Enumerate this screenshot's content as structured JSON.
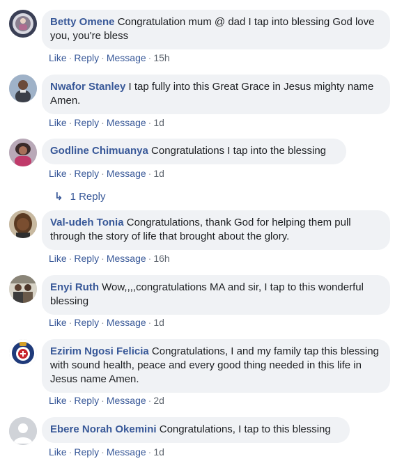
{
  "comments": [
    {
      "author": "Betty Omene",
      "text": "Congratulation mum @ dad I tap into blessing God love you, you're bless",
      "time": "15h"
    },
    {
      "author": "Nwafor Stanley",
      "text": "I tap fully into this Great Grace in Jesus mighty name Amen.",
      "time": "1d"
    },
    {
      "author": "Godline Chimuanya",
      "text": "Congratulations I tap into the blessing",
      "time": "1d"
    },
    {
      "author": "Val-udeh Tonia",
      "text": "Congratulations, thank God for helping them pull through the story of life that brought about the glory.",
      "time": "16h"
    },
    {
      "author": "Enyi Ruth",
      "text": "Wow,,,,congratulations MA and sir, I tap to this wonderful blessing",
      "time": "1d"
    },
    {
      "author": "Ezirim Ngosi Felicia",
      "text": "Congratulations, I and my family tap this blessing with sound health, peace and every good thing needed in this life in Jesus name Amen.",
      "time": "2d"
    },
    {
      "author": "Ebere Norah Okemini",
      "text": "Congratulations, I tap to this blessing",
      "time": "1d"
    }
  ],
  "actions": {
    "like": "Like",
    "reply": "Reply",
    "message": "Message"
  },
  "replies_link": {
    "arrow": "↳",
    "label": "1 Reply"
  },
  "colors": {
    "link": "#385898",
    "bubble": "#f0f2f5",
    "text": "#1c1e21",
    "meta": "#606770"
  }
}
